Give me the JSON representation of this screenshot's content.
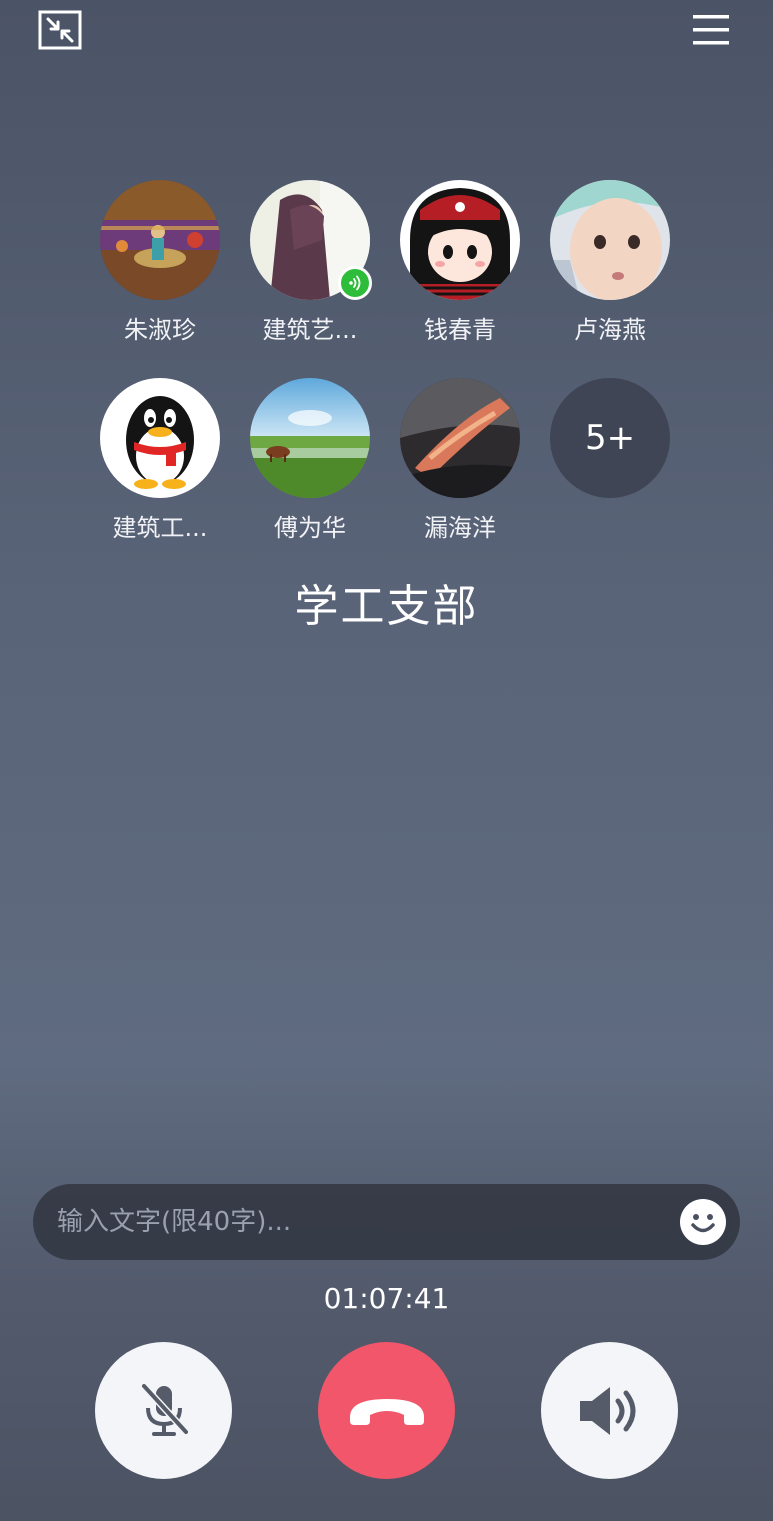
{
  "topbar": {
    "minimize_icon": "minimize-window-icon",
    "menu_icon": "hamburger-menu-icon"
  },
  "participants": [
    {
      "name": "朱淑珍",
      "avatar": "game-scene-avatar"
    },
    {
      "name": "建筑艺...",
      "avatar": "girl-long-hair-avatar",
      "speaking": true
    },
    {
      "name": "钱春青",
      "avatar": "pirate-girl-cartoon-avatar"
    },
    {
      "name": "卢海燕",
      "avatar": "baby-photo-avatar"
    },
    {
      "name": "建筑工...",
      "avatar": "penguin-avatar"
    },
    {
      "name": "傅为华",
      "avatar": "grassland-cow-avatar"
    },
    {
      "name": "漏海洋",
      "avatar": "sunset-cloud-avatar"
    }
  ],
  "more_count": "5+",
  "group_title": "学工支部",
  "chat": {
    "placeholder": "输入文字(限40字)...",
    "value": ""
  },
  "timer": "01:07:41",
  "controls": {
    "mute_icon": "mic-muted-icon",
    "hangup_icon": "phone-hangup-icon",
    "speaker_icon": "speaker-icon"
  },
  "colors": {
    "hangup": "#f1566a",
    "speaking_badge": "#2dbd3a",
    "control_bg": "#f4f5f8"
  }
}
